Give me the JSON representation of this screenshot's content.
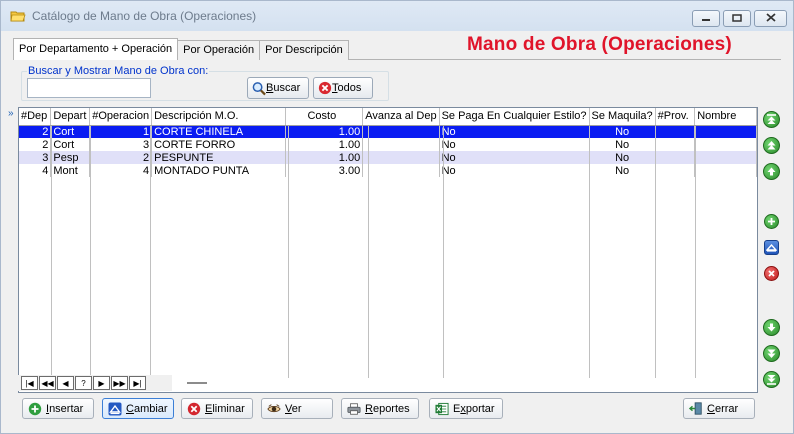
{
  "window": {
    "title": "Catálogo de Mano de Obra (Operaciones)"
  },
  "tabs": [
    {
      "label": "Por Departamento + Operación"
    },
    {
      "label": "Por Operación"
    },
    {
      "label": "Por Descripción"
    }
  ],
  "heading": "Mano de Obra (Operaciones)",
  "search": {
    "legend": "Buscar y Mostrar Mano de Obra con:",
    "value": "",
    "buscar_pre": "",
    "buscar_acc": "B",
    "buscar_post": "uscar",
    "todos_pre": "",
    "todos_acc": "T",
    "todos_post": "odos"
  },
  "grid": {
    "indicator": "»",
    "columns": [
      "#Dep",
      "Depart",
      "#Operacion",
      "Descripción M.O.",
      "Costo",
      "Avanza al Dep",
      "Se Paga En Cualquier Estilo?",
      "Se Maquila?",
      "#Prov.",
      "Nombre"
    ],
    "rows": [
      {
        "dep": "2",
        "depart": "Cort",
        "operacion": "1",
        "descripcion": "CORTE CHINELA",
        "costo": "1.00",
        "avanza": "",
        "paga": "No",
        "maquila": "No",
        "prov": "",
        "nombre": ""
      },
      {
        "dep": "2",
        "depart": "Cort",
        "operacion": "3",
        "descripcion": "CORTE FORRO",
        "costo": "1.00",
        "avanza": "",
        "paga": "No",
        "maquila": "No",
        "prov": "",
        "nombre": ""
      },
      {
        "dep": "3",
        "depart": "Pesp",
        "operacion": "2",
        "descripcion": "PESPUNTE",
        "costo": "1.00",
        "avanza": "",
        "paga": "No",
        "maquila": "No",
        "prov": "",
        "nombre": ""
      },
      {
        "dep": "4",
        "depart": "Mont",
        "operacion": "4",
        "descripcion": "MONTADO PUNTA",
        "costo": "3.00",
        "avanza": "",
        "paga": "No",
        "maquila": "No",
        "prov": "",
        "nombre": ""
      }
    ],
    "selected_row": 0
  },
  "navigator": [
    "|◀",
    "◀◀",
    "◀",
    "?",
    "▶",
    "▶▶",
    "▶|"
  ],
  "buttons": {
    "insertar": {
      "pre": "",
      "acc": "I",
      "post": "nsertar"
    },
    "cambiar": {
      "pre": "",
      "acc": "C",
      "post": "ambiar"
    },
    "eliminar": {
      "pre": "",
      "acc": "E",
      "post": "liminar"
    },
    "ver": {
      "pre": "",
      "acc": "V",
      "post": "er"
    },
    "reportes": {
      "pre": "",
      "acc": "R",
      "post": "eportes"
    },
    "exportar": {
      "pre": "E",
      "acc": "x",
      "post": "portar"
    },
    "cerrar": {
      "pre": "",
      "acc": "C",
      "post": "errar"
    }
  },
  "side_icons": [
    "first-record-icon",
    "previous-page-icon",
    "previous-record-icon",
    "insert-icon",
    "edit-icon",
    "delete-icon",
    "next-record-icon",
    "next-page-icon",
    "last-record-icon"
  ],
  "colors": {
    "heading": "#e0142a",
    "selected_row": "#0a1cf2",
    "alt_row": "#e0e0f8",
    "legend": "#0033cc"
  }
}
